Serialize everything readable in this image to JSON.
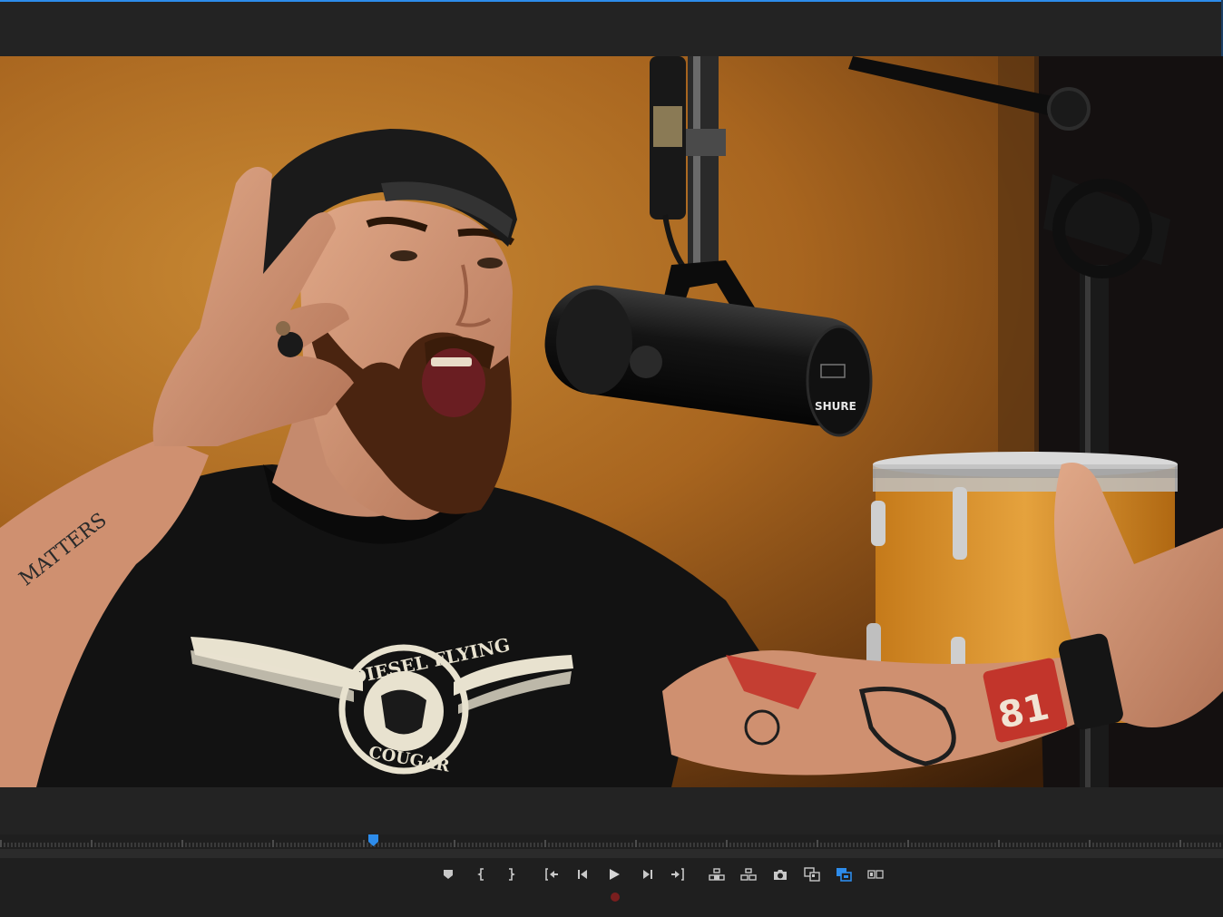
{
  "program_monitor": {
    "playhead_position": 0.305,
    "frame_content": {
      "mic_brand": "SHURE",
      "shirt_text_top": "DIESEL FLYING",
      "shirt_text_bottom": "COUGAR",
      "tattoo_text": "MATTERS",
      "tattoo_number": "81"
    },
    "controls": [
      {
        "name": "add-marker",
        "icon": "marker-icon"
      },
      {
        "name": "mark-in",
        "icon": "mark-in-icon"
      },
      {
        "name": "mark-out",
        "icon": "mark-out-icon"
      },
      {
        "name": "go-to-in",
        "icon": "go-to-in-icon"
      },
      {
        "name": "step-back",
        "icon": "step-back-icon"
      },
      {
        "name": "play",
        "icon": "play-icon"
      },
      {
        "name": "step-forward",
        "icon": "step-forward-icon"
      },
      {
        "name": "go-to-out",
        "icon": "go-to-out-icon"
      },
      {
        "name": "lift",
        "icon": "lift-icon"
      },
      {
        "name": "extract",
        "icon": "extract-icon"
      },
      {
        "name": "export-frame",
        "icon": "camera-icon"
      },
      {
        "name": "comparison-view",
        "icon": "comparison-icon"
      },
      {
        "name": "proxy-toggle",
        "icon": "proxy-icon",
        "active": true
      },
      {
        "name": "vr-video",
        "icon": "vr-icon"
      }
    ],
    "colors": {
      "accent": "#2d8ceb",
      "panel": "#1f1f1f",
      "record": "#7a1e1e"
    }
  }
}
